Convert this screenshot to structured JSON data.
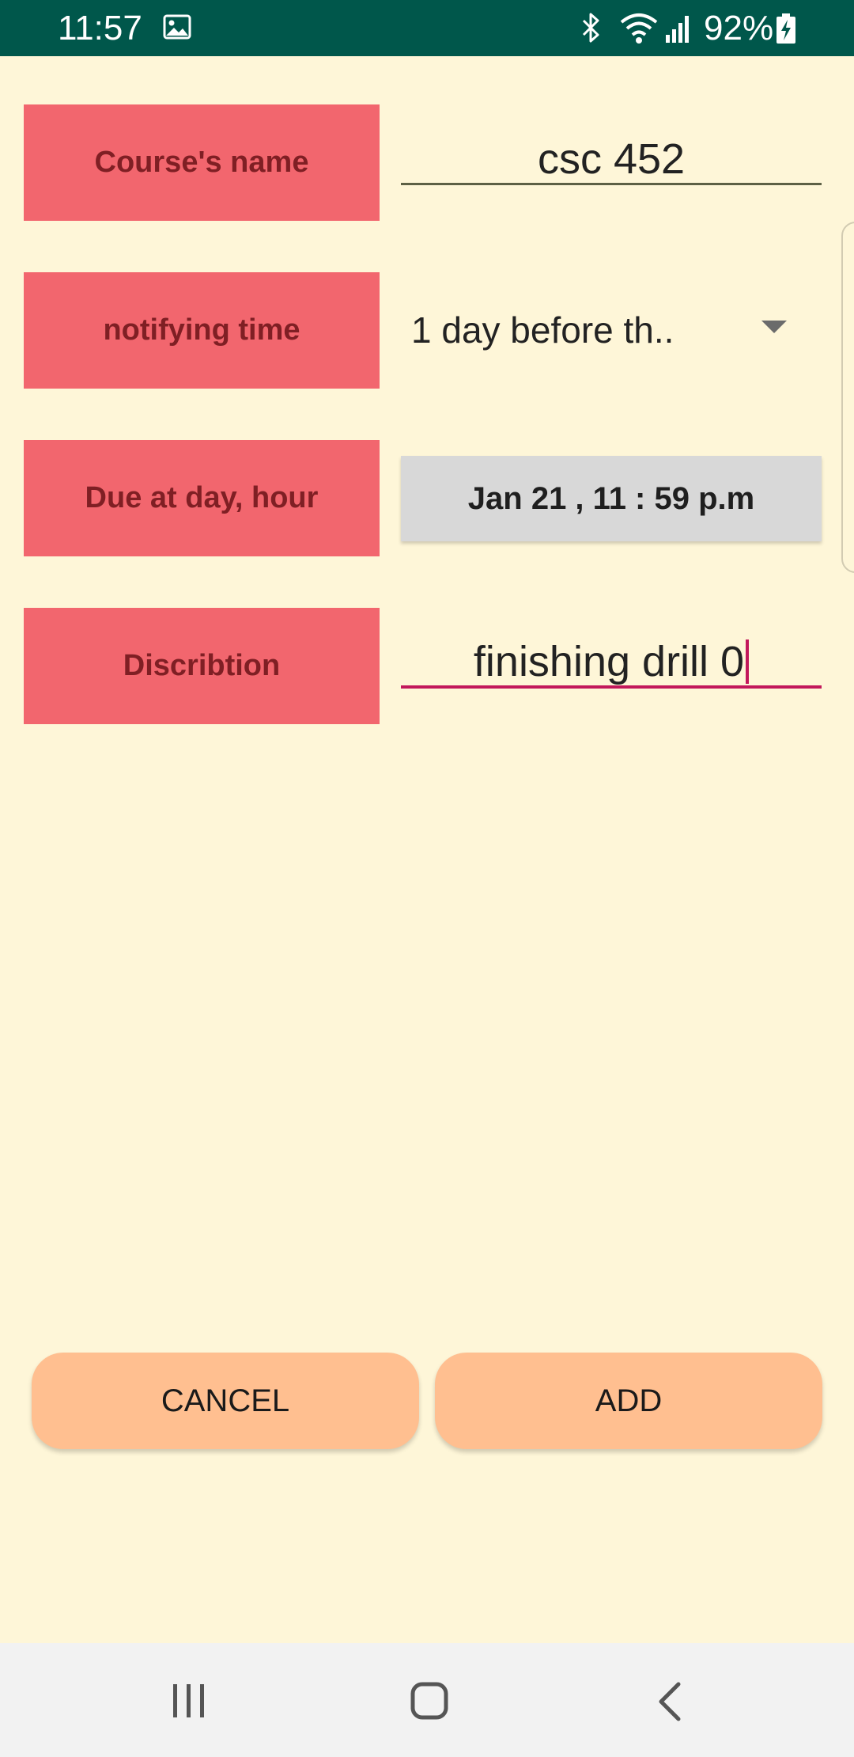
{
  "status_bar": {
    "time": "11:57",
    "battery": "92%",
    "icons": [
      "image-icon",
      "bluetooth-icon",
      "wifi-icon",
      "signal-icon",
      "battery-charging-icon"
    ]
  },
  "form": {
    "course_label": "Course's name",
    "course_value": "csc 452",
    "notify_label": "notifying time",
    "notify_value": "1 day before th..",
    "due_label": "Due at day, hour",
    "due_value": "Jan 21 , 11 : 59 p.m",
    "desc_label": "Discribtion",
    "desc_value": "finishing drill 0"
  },
  "actions": {
    "cancel_label": "CANCEL",
    "add_label": "ADD"
  },
  "nav": {
    "icons": [
      "recent-apps-icon",
      "home-icon",
      "back-icon"
    ]
  },
  "colors": {
    "status_bar": "#00574B",
    "background": "#FEF6D8",
    "label_box": "#F2666E",
    "label_text": "#7F1F24",
    "button": "#FFBF90",
    "accent": "#C2185B"
  }
}
